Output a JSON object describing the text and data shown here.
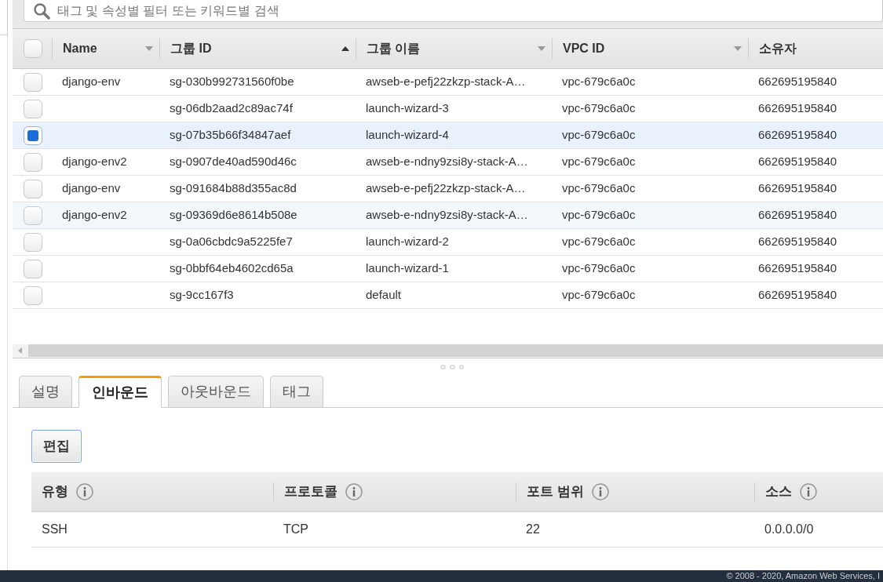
{
  "search": {
    "placeholder": "태그 및 속성별 필터 또는 키워드별 검색"
  },
  "table": {
    "all_checked": false,
    "columns": [
      {
        "label": "Name",
        "kind": "sortable"
      },
      {
        "label": "그룹 ID",
        "kind": "sorted"
      },
      {
        "label": "그룹 이름",
        "kind": "sortable"
      },
      {
        "label": "VPC ID",
        "kind": "sortable"
      },
      {
        "label": "소유자",
        "kind": "plain"
      }
    ],
    "rows": [
      {
        "selected": false,
        "hovered": false,
        "cells": [
          "django-env",
          "sg-030b992731560f0be",
          "awseb-e-pefj22zkzp-stack-A…",
          "vpc-679c6a0c",
          "662695195840"
        ]
      },
      {
        "selected": false,
        "hovered": false,
        "cells": [
          "",
          "sg-06db2aad2c89ac74f",
          "launch-wizard-3",
          "vpc-679c6a0c",
          "662695195840"
        ]
      },
      {
        "selected": true,
        "hovered": false,
        "cells": [
          "",
          "sg-07b35b66f34847aef",
          "launch-wizard-4",
          "vpc-679c6a0c",
          "662695195840"
        ]
      },
      {
        "selected": false,
        "hovered": false,
        "cells": [
          "django-env2",
          "sg-0907de40ad590d46c",
          "awseb-e-ndny9zsi8y-stack-A…",
          "vpc-679c6a0c",
          "662695195840"
        ]
      },
      {
        "selected": false,
        "hovered": false,
        "cells": [
          "django-env",
          "sg-091684b88d355ac8d",
          "awseb-e-pefj22zkzp-stack-A…",
          "vpc-679c6a0c",
          "662695195840"
        ]
      },
      {
        "selected": false,
        "hovered": true,
        "cells": [
          "django-env2",
          "sg-09369d6e8614b508e",
          "awseb-e-ndny9zsi8y-stack-A…",
          "vpc-679c6a0c",
          "662695195840"
        ]
      },
      {
        "selected": false,
        "hovered": false,
        "cells": [
          "",
          "sg-0a06cbdc9a5225fe7",
          "launch-wizard-2",
          "vpc-679c6a0c",
          "662695195840"
        ]
      },
      {
        "selected": false,
        "hovered": false,
        "cells": [
          "",
          "sg-0bbf64eb4602cd65a",
          "launch-wizard-1",
          "vpc-679c6a0c",
          "662695195840"
        ]
      },
      {
        "selected": false,
        "hovered": false,
        "cells": [
          "",
          "sg-9cc167f3",
          "default",
          "vpc-679c6a0c",
          "662695195840"
        ]
      }
    ]
  },
  "tabs": [
    {
      "label": "설명",
      "selected": false
    },
    {
      "label": "인바운드",
      "selected": true
    },
    {
      "label": "아웃바운드",
      "selected": false
    },
    {
      "label": "태그",
      "selected": false
    }
  ],
  "edit_button": "편집",
  "rules": {
    "columns": [
      "유형",
      "프로토콜",
      "포트 범위",
      "소스"
    ],
    "rows": [
      [
        "SSH",
        "TCP",
        "22",
        "0.0.0.0/0"
      ]
    ]
  },
  "footer": "© 2008 - 2020, Amazon Web Services, I"
}
